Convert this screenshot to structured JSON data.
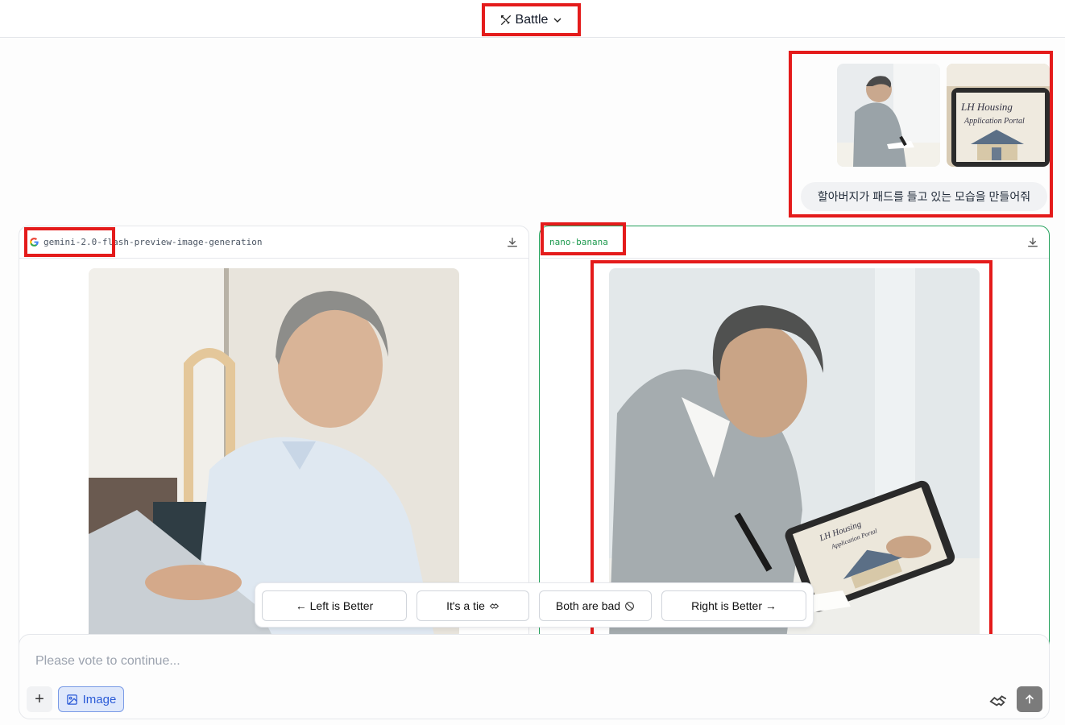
{
  "header": {
    "mode_label": "Battle"
  },
  "user_message": {
    "prompt": "할아버지가 패드를 들고 있는 모습을 만들어줘",
    "attachments": [
      {
        "kind": "photo",
        "caption": ""
      },
      {
        "kind": "photo",
        "text_line1": "LH Housing",
        "text_line2": "Application Portal"
      }
    ]
  },
  "left_panel": {
    "model": "gemini-2.0-flash-preview-image-generation",
    "download_icon": "download-icon"
  },
  "right_panel": {
    "model": "nano-banana",
    "download_icon": "download-icon",
    "tablet_text_line1": "LH Housing",
    "tablet_text_line2": "Application Portal"
  },
  "vote": {
    "left": "← Left is Better",
    "tie": "It's a tie",
    "bad": "Both are bad",
    "right": "Right is Better →"
  },
  "composer": {
    "placeholder": "Please vote to continue...",
    "image_label": "Image"
  },
  "colors": {
    "highlight": "#e41b1b",
    "accent_green": "#1e9a4f",
    "image_btn": "#2b5bd7"
  }
}
